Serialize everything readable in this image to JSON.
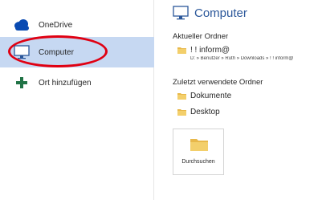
{
  "sidebar": {
    "items": [
      {
        "label": "OneDrive",
        "icon": "cloud-icon",
        "selected": false
      },
      {
        "label": "Computer",
        "icon": "monitor-icon",
        "selected": true
      },
      {
        "label": "Ort hinzufügen",
        "icon": "plus-icon",
        "selected": false
      }
    ]
  },
  "main": {
    "title": "Computer",
    "current_folder": {
      "heading": "Aktueller Ordner",
      "name": "! ! inform@",
      "path": "D: » Benutzer » Ruth » Downloads » ! ! inform@"
    },
    "recent": {
      "heading": "Zuletzt verwendete Ordner",
      "folders": [
        "Dokumente",
        "Desktop"
      ]
    },
    "browse_label": "Durchsuchen"
  },
  "colors": {
    "accent": "#2b579a",
    "selection": "#c6d8f2",
    "onedrive": "#094ab2",
    "add_place": "#217346",
    "folder": "#e8b84a",
    "annotation_ring": "#e00012"
  }
}
